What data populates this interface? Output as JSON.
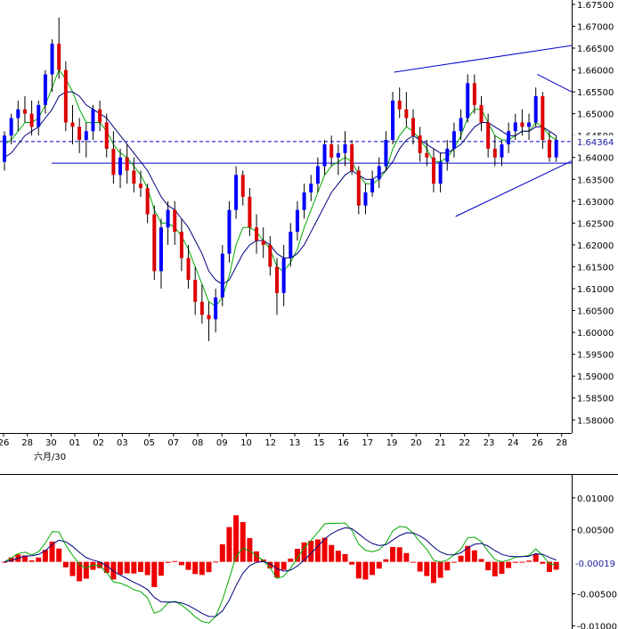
{
  "chart_data": [
    {
      "type": "candlestick",
      "price_axis": {
        "ylim": [
          1.577,
          1.676
        ],
        "ticks": [
          "1.67500",
          "1.67000",
          "1.66500",
          "1.66000",
          "1.65500",
          "1.65000",
          "1.64500",
          "1.64000",
          "1.63500",
          "1.63000",
          "1.62500",
          "1.62000",
          "1.61500",
          "1.61000",
          "1.60500",
          "1.60000",
          "1.59500",
          "1.59000",
          "1.58500",
          "1.58000"
        ],
        "current_price_label": "1.64364",
        "current_price": 1.64364,
        "horizontal_line": 1.6387
      },
      "date_axis": {
        "labels": [
          "26",
          "28",
          "30",
          "01",
          "02",
          "03",
          "05",
          "07",
          "08",
          "09",
          "10",
          "12",
          "13",
          "15",
          "16",
          "17",
          "19",
          "20",
          "21",
          "22",
          "23",
          "24",
          "26",
          "28"
        ],
        "month_label": "六月/30"
      },
      "colors": {
        "up": "#0000ff",
        "down": "#dd0000",
        "ma_fast": "#00aa00",
        "ma_slow": "#000080",
        "channel": "#0000cc",
        "macd_hist": "#ee0000"
      },
      "series": [
        {
          "ohlc": [
            [
              1.639,
              1.646,
              1.637,
              1.645
            ],
            [
              1.645,
              1.65,
              1.643,
              1.649
            ],
            [
              1.649,
              1.653,
              1.646,
              1.651
            ],
            [
              1.651,
              1.654,
              1.648,
              1.65
            ],
            [
              1.65,
              1.653,
              1.645,
              1.647
            ],
            [
              1.647,
              1.653,
              1.645,
              1.652
            ],
            [
              1.652,
              1.66,
              1.65,
              1.659
            ],
            [
              1.659,
              1.667,
              1.655,
              1.666
            ],
            [
              1.666,
              1.672,
              1.658,
              1.66
            ],
            [
              1.66,
              1.662,
              1.646,
              1.648
            ],
            [
              1.648,
              1.652,
              1.643,
              1.647
            ],
            [
              1.647,
              1.649,
              1.641,
              1.644
            ],
            [
              1.644,
              1.648,
              1.64,
              1.646
            ],
            [
              1.646,
              1.652,
              1.644,
              1.651
            ],
            [
              1.651,
              1.653,
              1.646,
              1.648
            ],
            [
              1.648,
              1.65,
              1.64,
              1.642
            ],
            [
              1.642,
              1.646,
              1.634,
              1.636
            ],
            [
              1.636,
              1.642,
              1.633,
              1.64
            ],
            [
              1.64,
              1.643,
              1.634,
              1.637
            ],
            [
              1.637,
              1.64,
              1.632,
              1.634
            ],
            [
              1.634,
              1.637,
              1.631,
              1.633
            ],
            [
              1.633,
              1.634,
              1.625,
              1.627
            ],
            [
              1.627,
              1.629,
              1.612,
              1.614
            ],
            [
              1.614,
              1.626,
              1.61,
              1.624
            ],
            [
              1.624,
              1.63,
              1.62,
              1.628
            ],
            [
              1.628,
              1.63,
              1.62,
              1.623
            ],
            [
              1.623,
              1.626,
              1.614,
              1.617
            ],
            [
              1.617,
              1.62,
              1.61,
              1.612
            ],
            [
              1.612,
              1.615,
              1.604,
              1.607
            ],
            [
              1.607,
              1.611,
              1.602,
              1.604
            ],
            [
              1.604,
              1.607,
              1.598,
              1.603
            ],
            [
              1.603,
              1.61,
              1.6,
              1.608
            ],
            [
              1.608,
              1.62,
              1.606,
              1.618
            ],
            [
              1.618,
              1.63,
              1.616,
              1.628
            ],
            [
              1.628,
              1.638,
              1.626,
              1.636
            ],
            [
              1.636,
              1.637,
              1.629,
              1.631
            ],
            [
              1.631,
              1.633,
              1.622,
              1.624
            ],
            [
              1.624,
              1.627,
              1.618,
              1.621
            ],
            [
              1.621,
              1.624,
              1.617,
              1.62
            ],
            [
              1.62,
              1.622,
              1.613,
              1.615
            ],
            [
              1.615,
              1.617,
              1.604,
              1.609
            ],
            [
              1.609,
              1.62,
              1.606,
              1.617
            ],
            [
              1.617,
              1.625,
              1.615,
              1.623
            ],
            [
              1.623,
              1.63,
              1.621,
              1.628
            ],
            [
              1.628,
              1.634,
              1.626,
              1.632
            ],
            [
              1.632,
              1.636,
              1.63,
              1.634
            ],
            [
              1.634,
              1.64,
              1.632,
              1.638
            ],
            [
              1.638,
              1.644,
              1.636,
              1.643
            ],
            [
              1.643,
              1.645,
              1.638,
              1.64
            ],
            [
              1.64,
              1.643,
              1.636,
              1.641
            ],
            [
              1.641,
              1.646,
              1.638,
              1.643
            ],
            [
              1.643,
              1.644,
              1.636,
              1.637
            ],
            [
              1.637,
              1.638,
              1.627,
              1.629
            ],
            [
              1.629,
              1.634,
              1.627,
              1.632
            ],
            [
              1.632,
              1.637,
              1.631,
              1.635
            ],
            [
              1.635,
              1.64,
              1.633,
              1.638
            ],
            [
              1.638,
              1.646,
              1.637,
              1.644
            ],
            [
              1.644,
              1.655,
              1.643,
              1.653
            ],
            [
              1.653,
              1.656,
              1.649,
              1.651
            ],
            [
              1.651,
              1.655,
              1.647,
              1.649
            ],
            [
              1.649,
              1.651,
              1.643,
              1.645
            ],
            [
              1.645,
              1.647,
              1.639,
              1.641
            ],
            [
              1.641,
              1.644,
              1.638,
              1.64
            ],
            [
              1.64,
              1.642,
              1.632,
              1.634
            ],
            [
              1.634,
              1.641,
              1.632,
              1.639
            ],
            [
              1.639,
              1.644,
              1.637,
              1.642
            ],
            [
              1.642,
              1.648,
              1.64,
              1.646
            ],
            [
              1.646,
              1.651,
              1.644,
              1.649
            ],
            [
              1.649,
              1.659,
              1.648,
              1.657
            ],
            [
              1.657,
              1.659,
              1.65,
              1.652
            ],
            [
              1.652,
              1.654,
              1.646,
              1.648
            ],
            [
              1.648,
              1.65,
              1.64,
              1.642
            ],
            [
              1.642,
              1.645,
              1.638,
              1.64
            ],
            [
              1.64,
              1.644,
              1.638,
              1.643
            ],
            [
              1.643,
              1.648,
              1.641,
              1.646
            ],
            [
              1.646,
              1.65,
              1.644,
              1.648
            ],
            [
              1.648,
              1.651,
              1.645,
              1.647
            ],
            [
              1.647,
              1.65,
              1.644,
              1.648
            ],
            [
              1.648,
              1.656,
              1.647,
              1.654
            ],
            [
              1.654,
              1.655,
              1.642,
              1.644
            ],
            [
              1.644,
              1.646,
              1.639,
              1.64
            ],
            [
              1.64,
              1.645,
              1.639,
              1.644
            ]
          ]
        },
        {
          "name": "",
          "values": [
            1.643,
            1.644,
            1.646,
            1.648,
            1.648,
            1.649,
            1.652,
            1.656,
            1.66,
            1.658,
            1.655,
            1.651,
            1.648,
            1.648,
            1.648,
            1.646,
            1.643,
            1.641,
            1.64,
            1.638,
            1.636,
            1.633,
            1.628,
            1.625,
            1.625,
            1.624,
            1.622,
            1.619,
            1.615,
            1.611,
            1.607,
            1.606,
            1.608,
            1.613,
            1.62,
            1.624,
            1.624,
            1.623,
            1.621,
            1.619,
            1.615,
            1.614,
            1.616,
            1.619,
            1.624,
            1.628,
            1.632,
            1.636,
            1.638,
            1.639,
            1.64,
            1.639,
            1.636,
            1.634,
            1.634,
            1.635,
            1.637,
            1.642,
            1.645,
            1.647,
            1.646,
            1.644,
            1.642,
            1.639,
            1.639,
            1.64,
            1.642,
            1.645,
            1.649,
            1.651,
            1.651,
            1.648,
            1.645,
            1.644,
            1.644,
            1.645,
            1.646,
            1.646,
            1.648,
            1.647,
            1.645,
            1.644
          ]
        },
        {
          "name": "",
          "values": [
            1.64,
            1.641,
            1.643,
            1.645,
            1.646,
            1.647,
            1.649,
            1.651,
            1.654,
            1.655,
            1.655,
            1.654,
            1.652,
            1.651,
            1.65,
            1.649,
            1.647,
            1.645,
            1.643,
            1.641,
            1.639,
            1.637,
            1.634,
            1.631,
            1.629,
            1.628,
            1.626,
            1.624,
            1.621,
            1.618,
            1.614,
            1.612,
            1.611,
            1.612,
            1.615,
            1.618,
            1.62,
            1.621,
            1.621,
            1.62,
            1.618,
            1.617,
            1.617,
            1.618,
            1.62,
            1.623,
            1.626,
            1.629,
            1.632,
            1.634,
            1.636,
            1.637,
            1.636,
            1.635,
            1.635,
            1.636,
            1.637,
            1.639,
            1.642,
            1.644,
            1.645,
            1.644,
            1.643,
            1.642,
            1.641,
            1.641,
            1.642,
            1.643,
            1.645,
            1.647,
            1.648,
            1.648,
            1.647,
            1.646,
            1.645,
            1.645,
            1.646,
            1.646,
            1.647,
            1.647,
            1.646,
            1.645
          ]
        }
      ],
      "channel_lines": [
        {
          "from": [
            58,
            1.6595
          ],
          "to": [
            81,
            1.6656
          ]
        },
        {
          "from": [
            67,
            1.6265
          ],
          "to": [
            81,
            1.6392
          ]
        },
        {
          "from": [
            79,
            1.659
          ],
          "to": [
            81,
            1.655
          ]
        }
      ]
    },
    {
      "type": "macd",
      "ylim": [
        -0.0105,
        0.0136
      ],
      "ticks": [
        "0.01000",
        "0.00500",
        "0.00000",
        "-0.00500",
        "-0.01000"
      ],
      "current_value_label": "-0.00019",
      "current_value": -0.00019
    }
  ]
}
